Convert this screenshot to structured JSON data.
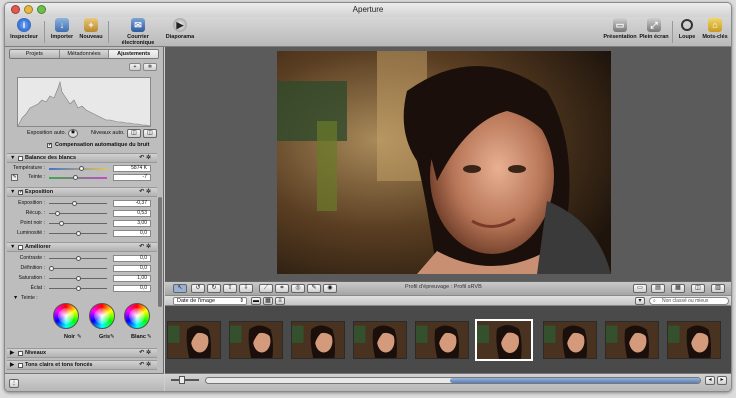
{
  "window": {
    "title": "Aperture"
  },
  "toolbar": {
    "inspector": "Inspecteur",
    "import": "Importer",
    "new": "Nouveau",
    "email": "Courrier électronique",
    "slideshow": "Diaporama",
    "presentation": "Présentation",
    "fullscreen": "Plein écran",
    "loupe": "Loupe",
    "keywords": "Mots-clés"
  },
  "tabs": [
    "Projets",
    "Métadonnées",
    "Ajustements"
  ],
  "histogram": {
    "auto_exposure": "Exposition auto.",
    "auto_levels": "Niveaux auto."
  },
  "noise_comp": "Compensation automatique du bruit",
  "white_balance": {
    "title": "Balance des blancs",
    "temperature_label": "Température :",
    "temperature_value": "5874 K",
    "temperature_level": 0.55,
    "tint_label": "Teinte :",
    "tint_value": "-7",
    "tint_level": 0.45
  },
  "exposure": {
    "title": "Exposition",
    "params": [
      {
        "label": "Exposition :",
        "value": "-0,37",
        "level": 0.42
      },
      {
        "label": "Récup. :",
        "value": "0,53",
        "level": 0.12
      },
      {
        "label": "Point noir :",
        "value": "3,00",
        "level": 0.18
      },
      {
        "label": "Luminosité :",
        "value": "0,0",
        "level": 0.5
      }
    ]
  },
  "enhance": {
    "title": "Améliorer",
    "params": [
      {
        "label": "Contraste :",
        "value": "0,0",
        "level": 0.5
      },
      {
        "label": "Définition :",
        "value": "0,0",
        "level": 0.0
      },
      {
        "label": "Saturation :",
        "value": "1,00",
        "level": 0.5
      },
      {
        "label": "Éclat :",
        "value": "0,0",
        "level": 0.5
      }
    ],
    "tints_label": "Teinte :",
    "black_label": "Noir",
    "gray_label": "Gris",
    "white_label": "Blanc"
  },
  "levels": {
    "title": "Niveaux"
  },
  "shadows": {
    "title": "Tons clairs et tons foncés"
  },
  "viewer": {
    "proof_label": "Profil d'épreuvage : Profil sRVB"
  },
  "browser": {
    "sort_value": "Date de l'image",
    "search_placeholder": "Non classé ou mieux"
  },
  "filmstrip": {
    "selected_index": 5
  }
}
